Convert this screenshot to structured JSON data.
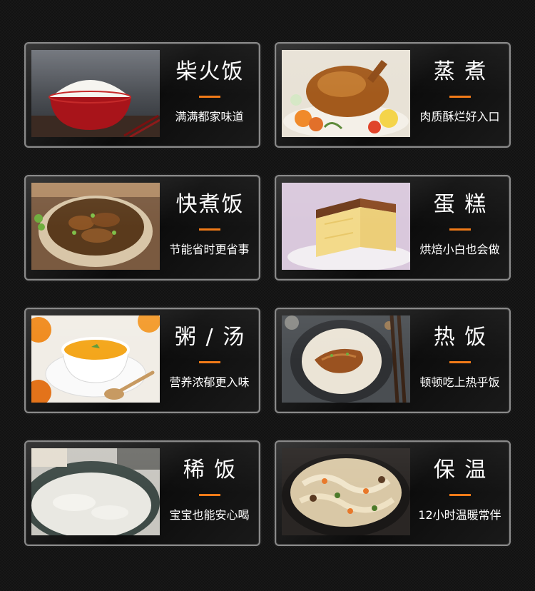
{
  "modes": [
    {
      "title": "柴火饭",
      "subtitle": "满满都家味道",
      "image": "rice-bowl-photo"
    },
    {
      "title": "蒸 煮",
      "subtitle": "肉质酥烂好入口",
      "image": "roast-chicken-photo"
    },
    {
      "title": "快煮饭",
      "subtitle": "节能省时更省事",
      "image": "eel-rice-pot-photo"
    },
    {
      "title": "蛋 糕",
      "subtitle": "烘焙小白也会做",
      "image": "sponge-cake-photo"
    },
    {
      "title": "粥 / 汤",
      "subtitle": "营养浓郁更入味",
      "image": "pumpkin-soup-photo"
    },
    {
      "title": "热 饭",
      "subtitle": "顿顿吃上热乎饭",
      "image": "eel-on-rice-plate-photo"
    },
    {
      "title": "稀 饭",
      "subtitle": "宝宝也能安心喝",
      "image": "congee-bowl-photo"
    },
    {
      "title": "保 温",
      "subtitle": "12小时温暖常伴",
      "image": "noodle-soup-pot-photo"
    }
  ],
  "colors": {
    "accent": "#f07a18",
    "text": "#ffffff",
    "background": "#121212",
    "card_border": "#8a8a8a"
  }
}
